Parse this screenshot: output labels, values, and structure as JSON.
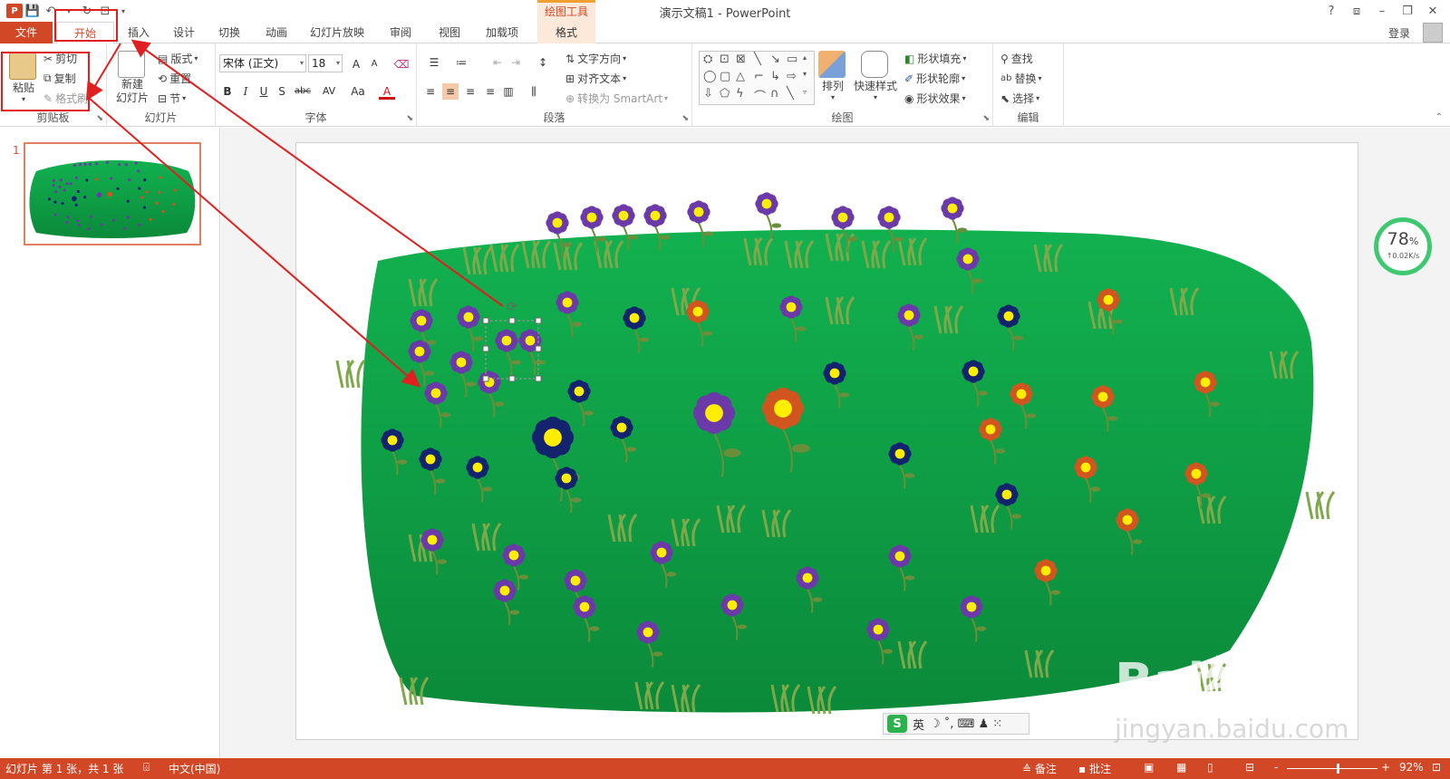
{
  "titlebar": {
    "context_label": "绘图工具",
    "doc_title": "演示文稿1 - PowerPoint",
    "help": "?",
    "ribbon_display": "⧈",
    "minimize": "–",
    "restore": "❐",
    "close": "✕"
  },
  "tabs": {
    "file": "文件",
    "home": "开始",
    "insert": "插入",
    "design": "设计",
    "transitions": "切换",
    "animations": "动画",
    "slideshow": "幻灯片放映",
    "review": "审阅",
    "view": "视图",
    "addins": "加载项",
    "format": "格式",
    "login": "登录"
  },
  "ribbon": {
    "clipboard": {
      "paste": "粘贴",
      "cut": "剪切",
      "copy": "复制",
      "format_painter": "格式刷",
      "label": "剪贴板"
    },
    "slides": {
      "new_slide_1": "新建",
      "new_slide_2": "幻灯片",
      "layout": "版式",
      "reset": "重置",
      "section": "节",
      "label": "幻灯片"
    },
    "font": {
      "font_name": "宋体 (正文)",
      "font_size": "18",
      "grow": "A",
      "shrink": "A",
      "bold": "B",
      "italic": "I",
      "underline": "U",
      "shadow": "S",
      "strike": "abc",
      "spacing": "AV",
      "case": "Aa",
      "color": "A",
      "label": "字体"
    },
    "paragraph": {
      "text_direction": "文字方向",
      "align_text": "对齐文本",
      "smartart": "转换为 SmartArt",
      "label": "段落"
    },
    "drawing": {
      "arrange": "排列",
      "quick_styles": "快速样式",
      "shape_fill": "形状填充",
      "shape_outline": "形状轮廓",
      "shape_effects": "形状效果",
      "label": "绘图"
    },
    "editing": {
      "find": "查找",
      "replace": "替换",
      "select": "选择",
      "label": "编辑"
    }
  },
  "thumbnail": {
    "number": "1"
  },
  "network": {
    "percent": "78",
    "percent_unit": "%",
    "speed": "↑0.02K/s"
  },
  "ime": {
    "lang": "英",
    "icons": "☽ ˚, ⌨ ♟ ⁙"
  },
  "watermark": {
    "brand": "Bai经验",
    "url": "jingyan.baidu.com"
  },
  "statusbar": {
    "slide_info": "幻灯片 第 1 张，共 1 张",
    "language": "中文(中国)",
    "notes": "备注",
    "comments": "批注",
    "zoom_minus": "-",
    "zoom_plus": "+",
    "zoom": "92%",
    "zoom_fraction": 0.55
  },
  "colors": {
    "accent": "#d24726",
    "meadow_top": "#12b150",
    "meadow_bottom": "#0b8a3a",
    "flower_purple": "#6b3aa8",
    "flower_navy": "#13236e",
    "flower_orange": "#d0551e",
    "flower_center": "#ffee00",
    "annotation_red": "#e02020"
  }
}
